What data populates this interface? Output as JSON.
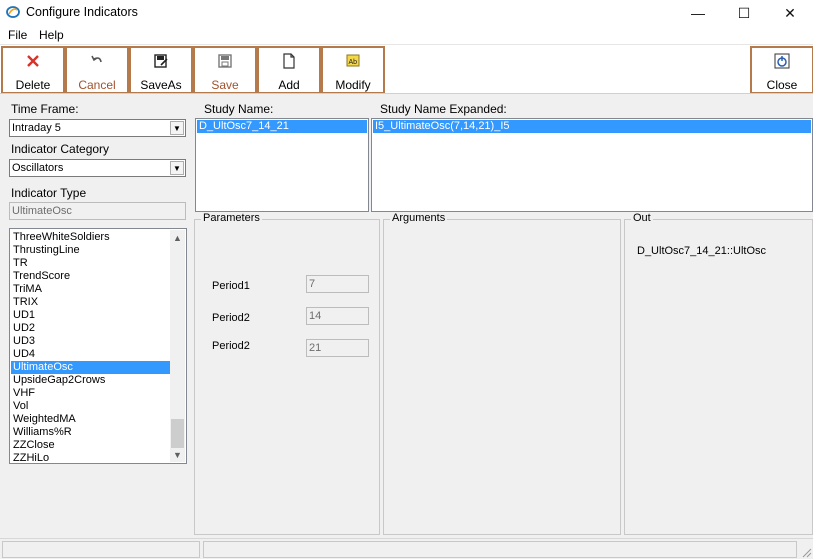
{
  "window": {
    "title": "Configure Indicators",
    "icon": "swirl-app-icon",
    "controls": {
      "minimize": "—",
      "maximize": "☐",
      "close": "✕"
    }
  },
  "menu": {
    "items": [
      "File",
      "Help"
    ]
  },
  "toolbar": {
    "buttons": [
      {
        "label": "Delete",
        "icon": "red-x-icon",
        "accent": "#d9322a"
      },
      {
        "label": "Cancel",
        "icon": "undo-arrow-icon"
      },
      {
        "label": "SaveAs",
        "icon": "save-as-icon"
      },
      {
        "label": "Save",
        "icon": "floppy-disk-icon"
      },
      {
        "label": "Add",
        "icon": "new-page-icon"
      },
      {
        "label": "Modify",
        "icon": "edit-text-icon"
      },
      {
        "label": "Close",
        "icon": "power-close-icon"
      }
    ]
  },
  "left": {
    "time_frame_label": "Time Frame:",
    "time_frame_value": "Intraday 5",
    "category_label": "Indicator Category",
    "category_value": "Oscillators",
    "type_label": "Indicator Type",
    "type_value": "UltimateOsc",
    "indicators": [
      "ThreeWhiteSoldiers",
      "ThrustingLine",
      "TR",
      "TrendScore",
      "TriMA",
      "TRIX",
      "UD1",
      "UD2",
      "UD3",
      "UD4",
      "UltimateOsc",
      "UpsideGap2Crows",
      "VHF",
      "Vol",
      "WeightedMA",
      "Williams%R",
      "ZZClose",
      "ZZHiLo"
    ],
    "selected_indicator": "UltimateOsc"
  },
  "study": {
    "name_label": "Study Name:",
    "name_value": "D_UltOsc7_14_21",
    "expanded_label": "Study Name Expanded:",
    "expanded_value": "I5_UltimateOsc(7,14,21)_I5"
  },
  "parameters": {
    "title": "Parameters",
    "items": [
      {
        "label": "Period1",
        "value": "7"
      },
      {
        "label": "Period2",
        "value": "14"
      },
      {
        "label": "Period2",
        "value": "21"
      }
    ]
  },
  "arguments": {
    "title": "Arguments"
  },
  "out": {
    "title": "Out",
    "value": "D_UltOsc7_14_21::UltOsc"
  },
  "colors": {
    "selection": "#3399ff",
    "button_border": "#b57a4c",
    "delete_red": "#d9322a"
  }
}
